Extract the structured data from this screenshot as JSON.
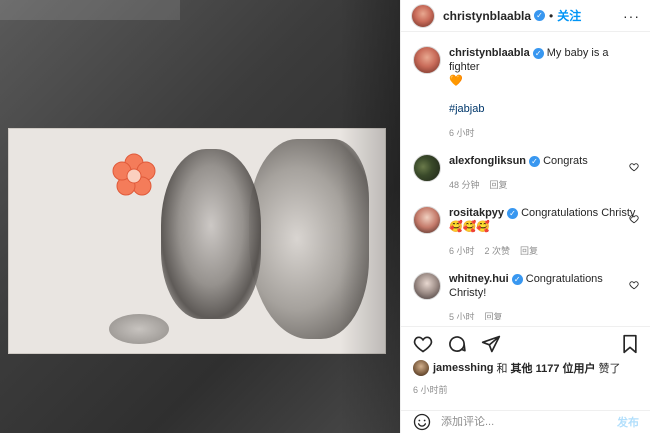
{
  "header": {
    "username": "christynblaabla",
    "follow_label": "关注",
    "more_label": "···"
  },
  "caption": {
    "username": "christynblaabla",
    "text": "My baby is a fighter",
    "emoji": "🧡",
    "hashtag": "#jabjab",
    "time": "6 小时"
  },
  "comments": [
    {
      "username": "alexfongliksun",
      "text": "Congrats",
      "time": "48 分钟",
      "reply": "回复",
      "likes": ""
    },
    {
      "username": "rositakpyy",
      "text": "Congratulations Christy 🥰🥰🥰",
      "time": "6 小时",
      "likes": "2 次赞",
      "reply": "回复"
    },
    {
      "username": "whitney.hui",
      "text": "Congratulations Christy!",
      "time": "5 小时",
      "likes": "",
      "reply": "回复"
    }
  ],
  "likes": {
    "user": "jamesshing",
    "connector": "和",
    "others": "其他 1177 位用户",
    "suffix": "赞了"
  },
  "post_time": "6 小时前",
  "comment_box": {
    "placeholder": "添加评论...",
    "publish_label": "发布"
  },
  "colors": {
    "link_blue": "#0095f6",
    "verified_blue": "#3897f0",
    "hashtag": "#00376b",
    "meta_gray": "#8e8e8e",
    "publish_disabled": "#b2dffc",
    "heart_orange": "#f7931e"
  },
  "icons": [
    "verified-badge-icon",
    "heart-icon",
    "comment-icon",
    "share-icon",
    "bookmark-icon",
    "smile-icon",
    "like-icon"
  ]
}
